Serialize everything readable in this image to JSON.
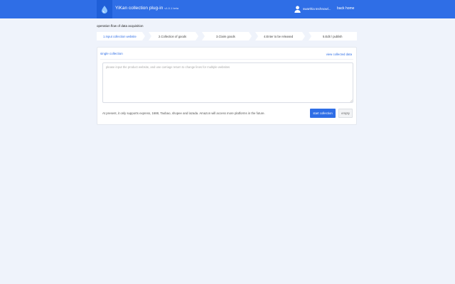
{
  "header": {
    "title": "YiKan collection plug-in",
    "version": "v1.0.1 beta",
    "user_name": "swarthia technowl...",
    "back_home_label": "back home",
    "logo_icon": "water-drop-icon",
    "user_icon": "user-icon",
    "accent_color": "#2f6ee6"
  },
  "flow": {
    "title": "operation flow of data acquisition",
    "steps": [
      {
        "label": "1.Input collection website",
        "active": true
      },
      {
        "label": "2.Collection of goods",
        "active": false
      },
      {
        "label": "3.Claim goods",
        "active": false
      },
      {
        "label": "4.Enter to be released",
        "active": false
      },
      {
        "label": "5.Edit / publish",
        "active": false
      }
    ]
  },
  "collection": {
    "title": "single collection",
    "view_link": "view collected data",
    "input_placeholder": "please input the product website, and use carriage return to change lines for multiple websites",
    "input_value": "",
    "note": "At present, it only supports express, 1688, Taobao, shopee and lazada. Amazon will access more platforms in the future.",
    "start_button": "start collection",
    "empty_button": "empty"
  }
}
